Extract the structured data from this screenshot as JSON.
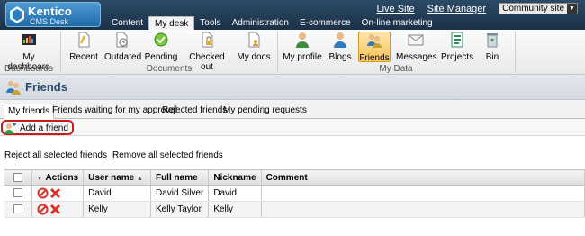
{
  "logo": {
    "brand": "Kentico",
    "sub": "CMS Desk"
  },
  "toplinks": {
    "live_site": "Live Site",
    "site_manager": "Site Manager",
    "site_selector": "Community site"
  },
  "main_tabs": [
    "Content",
    "My desk",
    "Tools",
    "Administration",
    "E-commerce",
    "On-line marketing"
  ],
  "ribbon": {
    "dashboards": {
      "group": "Dashboards",
      "items": [
        "My dashboard"
      ]
    },
    "documents": {
      "group": "Documents",
      "items": [
        "Recent",
        "Outdated",
        "Pending",
        "Checked out",
        "My docs"
      ]
    },
    "mydata": {
      "group": "My Data",
      "items": [
        "My profile",
        "Blogs",
        "Friends",
        "Messages",
        "Projects",
        "Bin"
      ]
    }
  },
  "page_title": "Friends",
  "sub_tabs": [
    "My friends",
    "Friends waiting for my approval",
    "Rejected friends",
    "My pending requests"
  ],
  "add_friend": "Add a friend",
  "bulk": {
    "reject": "Reject all selected friends",
    "remove": "Remove all selected friends"
  },
  "grid": {
    "headers": {
      "actions": "Actions",
      "username": "User name",
      "fullname": "Full name",
      "nickname": "Nickname",
      "comment": "Comment"
    },
    "rows": [
      {
        "username": "David",
        "fullname": "David Silver",
        "nickname": "David",
        "comment": ""
      },
      {
        "username": "Kelly",
        "fullname": "Kelly Taylor",
        "nickname": "Kelly",
        "comment": ""
      }
    ]
  },
  "colors": {
    "header_bg": "#1c3147",
    "active_ribbon": "#f6c55c",
    "title_text": "#2a4a6b",
    "highlight_border": "#c81d1d"
  }
}
